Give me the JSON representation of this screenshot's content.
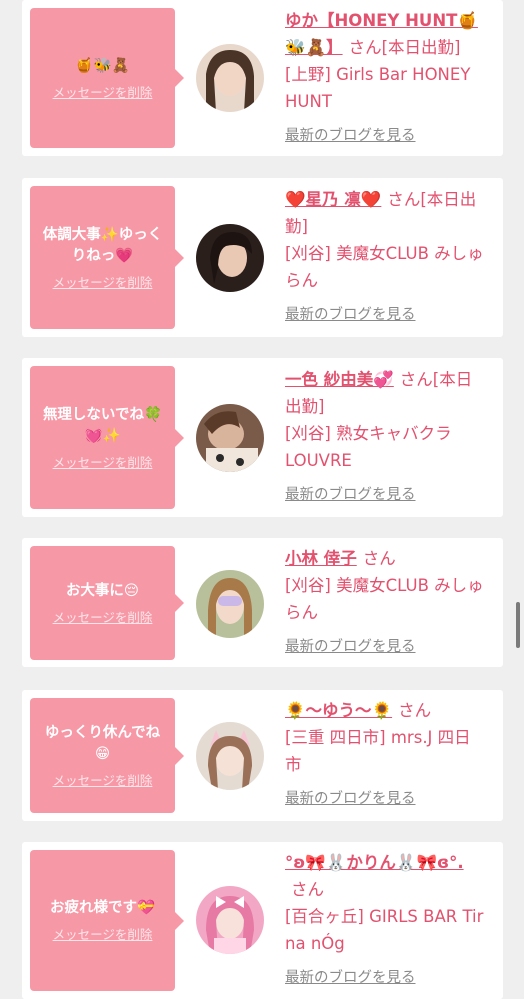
{
  "messages": [
    {
      "bubble_text": "🍯🐝🧸",
      "delete_label": "メッセージを削除",
      "name": "ゆか【HONEY HUNT🍯🐝🧸】",
      "honorific": "さん[本日出勤]",
      "shop": "[上野] Girls Bar HONEY HUNT",
      "blog_label": "最新のブログを見る",
      "avatar_color": "#b89a8a"
    },
    {
      "bubble_text": "体調大事✨ゆっくりねっ💗",
      "delete_label": "メッセージを削除",
      "name": "❤️星乃 凛❤️",
      "honorific": "さん[本日出勤]",
      "shop": "[刈谷] 美魔女CLUB みしゅらん",
      "blog_label": "最新のブログを見る",
      "avatar_color": "#3a2b28"
    },
    {
      "bubble_text": "無理しないでね🍀💓✨",
      "delete_label": "メッセージを削除",
      "name": "一色 紗由美💞",
      "honorific": "さん[本日出勤]",
      "shop": "[刈谷] 熟女キャバクラ LOUVRE",
      "blog_label": "最新のブログを見る",
      "avatar_color": "#8a6a58"
    },
    {
      "bubble_text": "お大事に😔",
      "delete_label": "メッセージを削除",
      "name": "小林 倖子",
      "honorific": "さん",
      "shop": "[刈谷] 美魔女CLUB みしゅらん",
      "blog_label": "最新のブログを見る",
      "avatar_color": "#9aa57a"
    },
    {
      "bubble_text": "ゆっくり休んでね😁",
      "delete_label": "メッセージを削除",
      "name": "🌻〜ゆう〜🌻",
      "honorific": "さん",
      "shop": "[三重 四日市] mrs.J 四日市",
      "blog_label": "最新のブログを見る",
      "avatar_color": "#c9b8a8"
    },
    {
      "bubble_text": "お疲れ様です💝",
      "delete_label": "メッセージを削除",
      "name": "°ʚ🎀🐰かりん🐰🎀ɞ°.",
      "honorific": "さん",
      "shop": "[百合ヶ丘] GIRLS BAR Tir na nÓg",
      "blog_label": "最新のブログを見る",
      "avatar_color": "#e99ab8"
    }
  ]
}
